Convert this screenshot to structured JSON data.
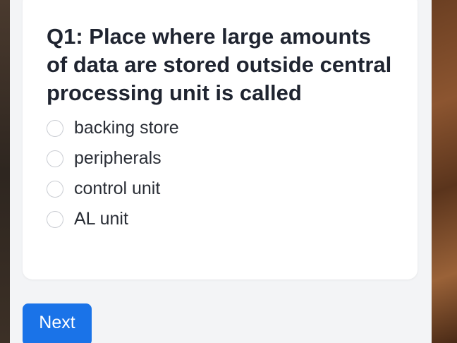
{
  "quiz": {
    "question": "Q1: Place where large amounts of data are stored outside central processing unit is called",
    "options": [
      {
        "label": "backing store",
        "selected": false
      },
      {
        "label": "peripherals",
        "selected": false
      },
      {
        "label": "control unit",
        "selected": false
      },
      {
        "label": "AL unit",
        "selected": false
      }
    ]
  },
  "actions": {
    "next_label": "Next"
  },
  "colors": {
    "accent": "#1a73e8",
    "card_background": "#ffffff",
    "page_background": "#f3f4f6"
  }
}
